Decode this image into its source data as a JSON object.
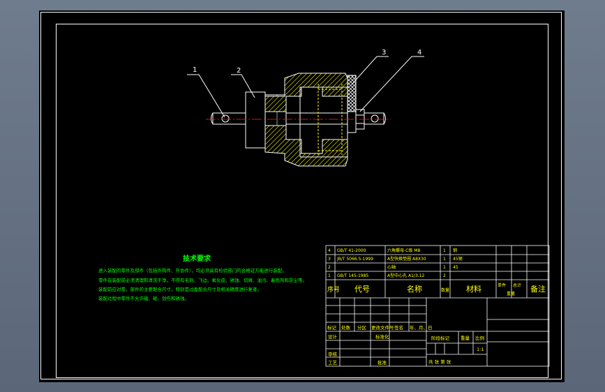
{
  "drawing": {
    "callouts": [
      "1",
      "2",
      "3",
      "4"
    ]
  },
  "tech_requirements": {
    "title": "技术要求",
    "lines": [
      "进入装配的零件及部件（包括外购件、外协件），均必须具有检验部门的合格证方能进行装配。",
      "零件在装配前必须清理和清洗干净，不得有毛刺、飞边、氧化皮、锈蚀、切屑、油污、着色剂和灰尘等。",
      "装配前应对零、部件的主要配合尺寸，特别是过盈配合尺寸及相关精度进行复查。",
      "装配过程中零件不允许磕、碰、划伤和锈蚀。"
    ]
  },
  "bom": {
    "rows": [
      {
        "seq": "4",
        "code": "GB/T 41-2000",
        "name": "六角螺母-C级 M8",
        "qty": "1",
        "material": "钢"
      },
      {
        "seq": "3",
        "code": "JB/T 5066.5-1999",
        "name": "A型快换垫圈 A8X30",
        "qty": "1",
        "material": "45钢"
      },
      {
        "seq": "2",
        "code": "",
        "name": "心轴",
        "qty": "1",
        "material": "45"
      },
      {
        "seq": "1",
        "code": "GB/T 145-1985",
        "name": "A型中心孔 A1/3.12",
        "qty": "2",
        "material": ""
      }
    ],
    "header": {
      "seq": "序号",
      "code": "代号",
      "name": "名称",
      "qty": "数量",
      "material": "材料",
      "unit_weight": "单件",
      "total_weight": "总计",
      "weight": "重量",
      "remarks": "备注"
    }
  },
  "title_block": {
    "mark": "标记",
    "count": "处数",
    "zone": "分区",
    "change_doc": "更改文件号",
    "sign": "签名",
    "date": "年、月、日",
    "design": "设计",
    "standardize": "标准化",
    "review": "审核",
    "process": "工艺",
    "approve": "批准",
    "stage_mark": "阶段标记",
    "weight": "重量",
    "scale": "比例",
    "scale_value": "1:1",
    "sheets": "共  张  第  张"
  }
}
